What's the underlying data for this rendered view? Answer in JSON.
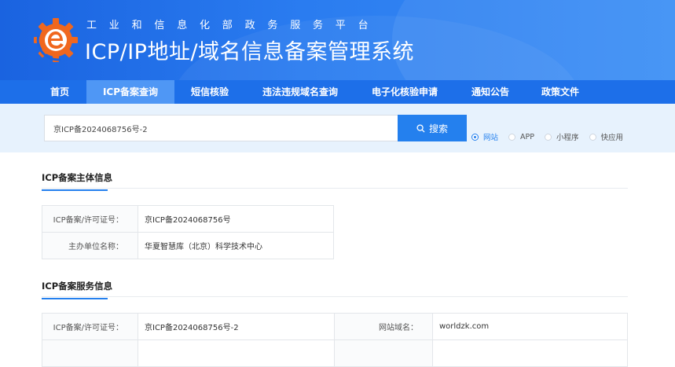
{
  "header": {
    "subtitle": "工业和信息化部政务服务平台",
    "title": "ICP/IP地址/域名信息备案管理系统"
  },
  "nav": {
    "items": [
      {
        "label": "首页",
        "active": false
      },
      {
        "label": "ICP备案查询",
        "active": true
      },
      {
        "label": "短信核验",
        "active": false
      },
      {
        "label": "违法违规域名查询",
        "active": false
      },
      {
        "label": "电子化核验申请",
        "active": false
      },
      {
        "label": "通知公告",
        "active": false
      },
      {
        "label": "政策文件",
        "active": false
      }
    ]
  },
  "search": {
    "value": "京ICP备2024068756号-2",
    "button_label": "搜索",
    "options": [
      {
        "label": "网站",
        "checked": true
      },
      {
        "label": "APP",
        "checked": false
      },
      {
        "label": "小程序",
        "checked": false
      },
      {
        "label": "快应用",
        "checked": false
      }
    ]
  },
  "subject_section": {
    "title": "ICP备案主体信息",
    "rows": [
      {
        "key": "ICP备案/许可证号：",
        "value": "京ICP备2024068756号"
      },
      {
        "key": "主办单位名称：",
        "value": "华夏智慧库（北京）科学技术中心"
      }
    ]
  },
  "service_section": {
    "title": "ICP备案服务信息",
    "rows": [
      {
        "key": "ICP备案/许可证号：",
        "value": "京ICP备2024068756号-2",
        "key2": "网站域名：",
        "value2": "worldzk.com"
      }
    ]
  },
  "colors": {
    "banner": "#1a63e0",
    "nav": "#1d6fe9",
    "nav_active": "#4f97f5",
    "accent": "#2480ee",
    "search_band": "#e7f2fd"
  }
}
